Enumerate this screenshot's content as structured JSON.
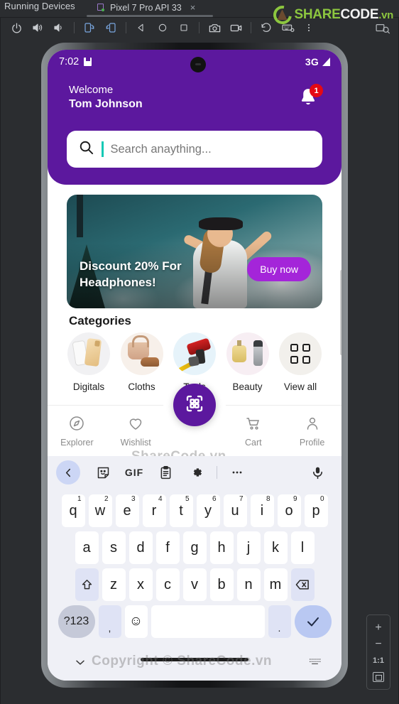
{
  "ide": {
    "tool_window_title": "Running Devices",
    "device_tab": {
      "label": "Pixel 7 Pro API 33",
      "close_label": "×",
      "device_icon": "android-device-icon"
    },
    "toolbar_buttons": [
      {
        "name": "power-button",
        "label": "Power"
      },
      {
        "name": "volume-up-button",
        "label": "Volume Up"
      },
      {
        "name": "volume-down-button",
        "label": "Volume Down"
      },
      {
        "name": "rotate-left-button",
        "label": "Rotate Left"
      },
      {
        "name": "rotate-right-button",
        "label": "Rotate Right"
      },
      {
        "name": "back-button",
        "label": "Back"
      },
      {
        "name": "home-button",
        "label": "Home"
      },
      {
        "name": "overview-button",
        "label": "Overview"
      },
      {
        "name": "screenshot-button",
        "label": "Take Screenshot"
      },
      {
        "name": "record-button",
        "label": "Record Screen"
      },
      {
        "name": "rotate-reset-button",
        "label": "Reset"
      },
      {
        "name": "hardware-input-button",
        "label": "Hardware Input"
      },
      {
        "name": "more-button",
        "label": "More"
      }
    ],
    "zoom_controls": {
      "zoom_in": "+",
      "zoom_out": "−",
      "actual_size": "1:1",
      "fit_label": "Zoom to Fit"
    }
  },
  "logo": {
    "part1": "SHARE",
    "part2": "CODE",
    "part3": ".vn"
  },
  "watermark": {
    "center": "ShareCode.vn",
    "bottom": "Copyright © ShareCode.vn"
  },
  "phone": {
    "status_bar": {
      "time": "7:02",
      "network": "3G",
      "save_icon": "save-icon",
      "signal_icon": "signal-icon"
    },
    "header": {
      "greeting": "Welcome",
      "user_name": "Tom Johnson",
      "notification_count": "1",
      "bell_icon": "bell-icon"
    },
    "search": {
      "placeholder": "Search anaything...",
      "value": "",
      "icon": "search-icon"
    },
    "banner": {
      "line1": "Discount 20% For",
      "line2": "Headphones!",
      "cta_label": "Buy now"
    },
    "categories": {
      "title": "Categories",
      "items": [
        {
          "label": "Digitals",
          "icon": "smartphone-icon"
        },
        {
          "label": "Cloths",
          "icon": "handbag-shoe-icon"
        },
        {
          "label": "Tools",
          "icon": "drill-icon"
        },
        {
          "label": "Beauty",
          "icon": "perfume-shaver-icon"
        },
        {
          "label": "View all",
          "icon": "grid-icon"
        }
      ]
    },
    "fab": {
      "icon": "qr-scan-icon",
      "label": "Scan"
    },
    "bottom_nav": [
      {
        "label": "Explorer",
        "icon": "compass-icon"
      },
      {
        "label": "Wishlist",
        "icon": "heart-icon"
      },
      {
        "label": "Cart",
        "icon": "cart-icon"
      },
      {
        "label": "Profile",
        "icon": "person-icon"
      }
    ]
  },
  "keyboard": {
    "toolbar": [
      {
        "name": "keyboard-back-button",
        "icon": "chevron-left-icon"
      },
      {
        "name": "sticker-button",
        "icon": "sticker-icon"
      },
      {
        "name": "gif-button",
        "icon": "gif-icon",
        "label": "GIF"
      },
      {
        "name": "clipboard-button",
        "icon": "clipboard-icon"
      },
      {
        "name": "keyboard-settings-button",
        "icon": "gear-icon"
      },
      {
        "name": "more-options-button",
        "icon": "ellipsis-icon"
      },
      {
        "name": "voice-input-button",
        "icon": "microphone-icon"
      }
    ],
    "row1": [
      {
        "k": "q",
        "n": "1"
      },
      {
        "k": "w",
        "n": "2"
      },
      {
        "k": "e",
        "n": "3"
      },
      {
        "k": "r",
        "n": "4"
      },
      {
        "k": "t",
        "n": "5"
      },
      {
        "k": "y",
        "n": "6"
      },
      {
        "k": "u",
        "n": "7"
      },
      {
        "k": "i",
        "n": "8"
      },
      {
        "k": "o",
        "n": "9"
      },
      {
        "k": "p",
        "n": "0"
      }
    ],
    "row2": [
      "a",
      "s",
      "d",
      "f",
      "g",
      "h",
      "j",
      "k",
      "l"
    ],
    "row3": [
      "z",
      "x",
      "c",
      "v",
      "b",
      "n",
      "m"
    ],
    "shift_label": "⇧",
    "backspace_label": "⌫",
    "symbols_label": "?123",
    "comma_label": ",",
    "emoji_label": "☺",
    "space_label": "",
    "period_label": ".",
    "enter_label": "✓",
    "hide_label": "⌄",
    "switch_label": "keyboard-switch-icon"
  }
}
